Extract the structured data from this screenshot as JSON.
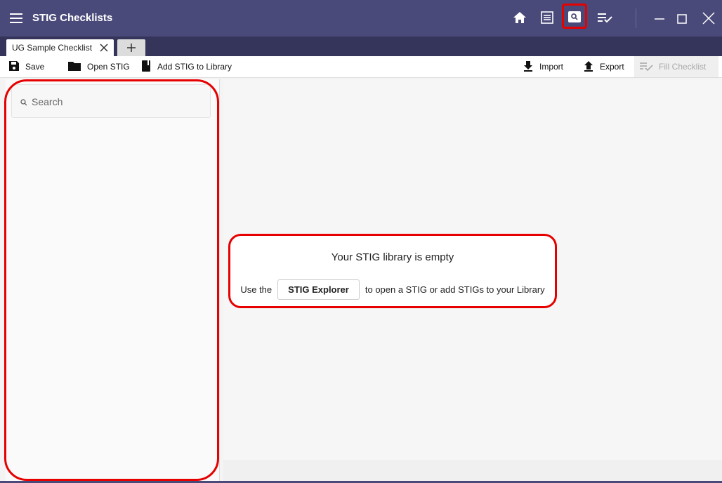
{
  "app": {
    "title": "STIG Checklists"
  },
  "tabs": [
    {
      "label": "UG Sample Checklist"
    }
  ],
  "toolbar": {
    "save": "Save",
    "open_stig": "Open STIG",
    "add_stig": "Add STIG to Library",
    "import": "Import",
    "export": "Export",
    "fill_checklist": "Fill Checklist"
  },
  "search": {
    "placeholder": "Search",
    "value": ""
  },
  "library": {
    "empty_title": "Your STIG library is empty",
    "use_the": "Use the",
    "explorer_button": "STIG Explorer",
    "suffix": "to open a STIG or add STIGs to your Library"
  },
  "colors": {
    "titlebar": "#4a4a7a",
    "tabrow": "#35345a",
    "highlight": "#e60000"
  }
}
